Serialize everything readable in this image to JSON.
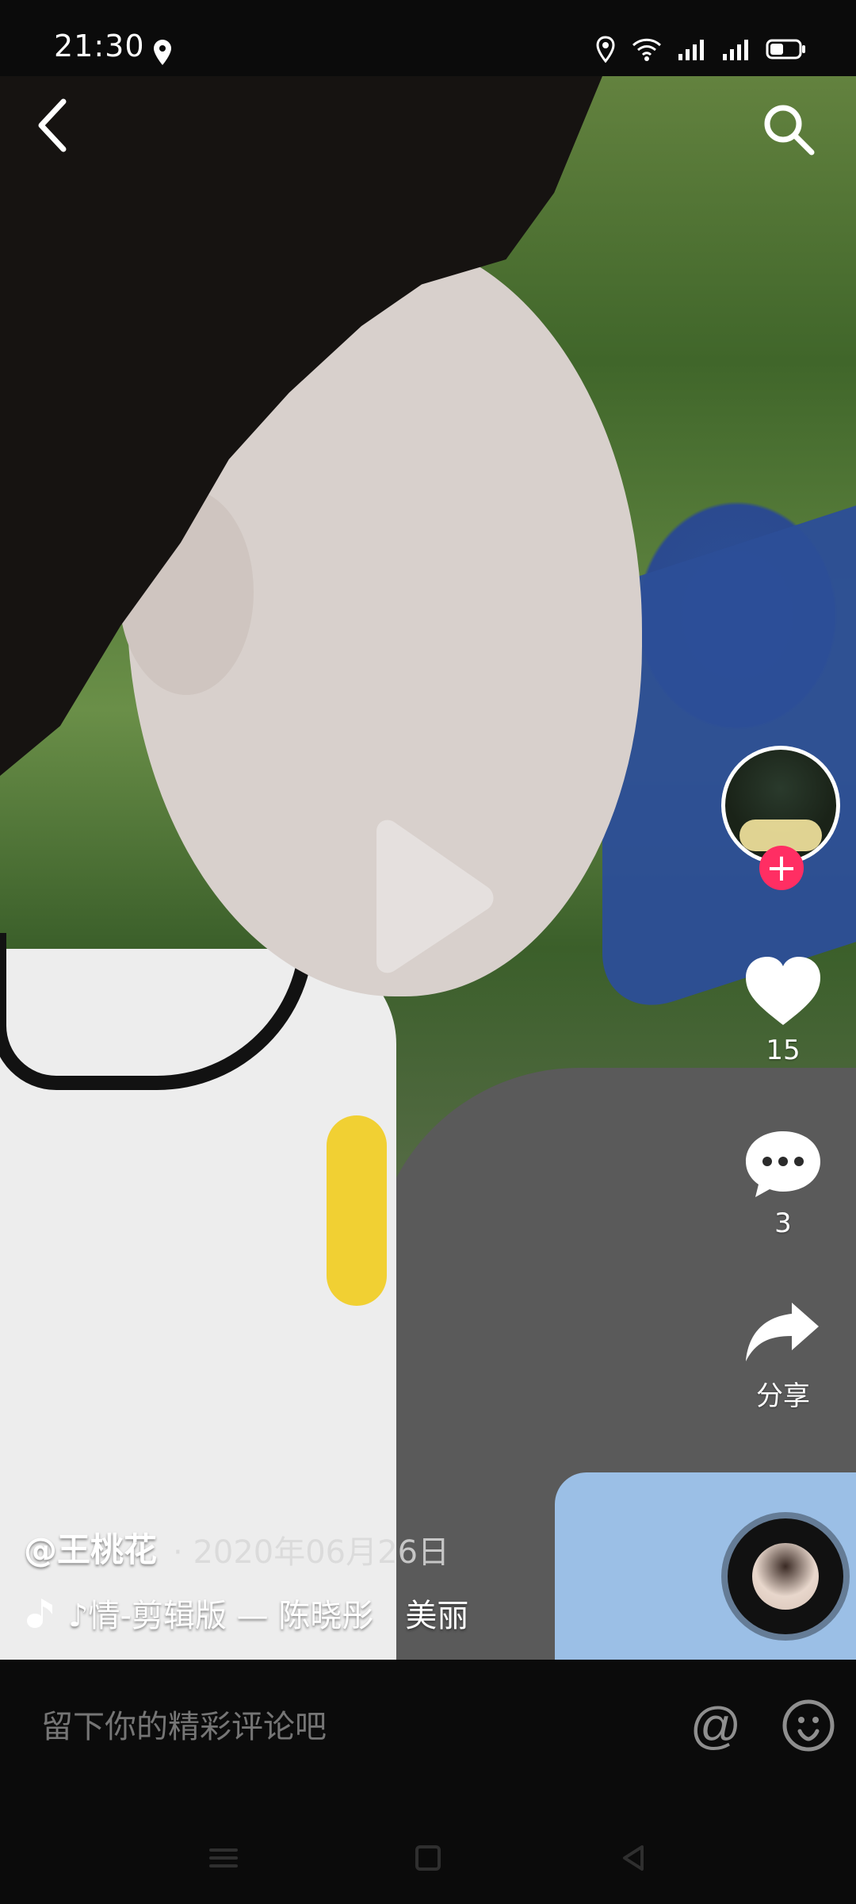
{
  "status_bar": {
    "time": "21:30"
  },
  "top_bar": {
    "back_label": "<",
    "search_label": "search"
  },
  "video": {
    "play_state": "paused"
  },
  "actions": {
    "like_count": "15",
    "comment_count": "3",
    "share_label": "分享",
    "follow_label": "+"
  },
  "post": {
    "author": "@王桃花",
    "date_separator": "·",
    "date": "2020年06月26日",
    "music": "♪情-剪辑版 — 陈晓彤　美丽"
  },
  "comment": {
    "placeholder": "留下你的精彩评论吧",
    "at_label": "@"
  },
  "colors": {
    "accent": "#ff2e63",
    "background": "#0b0b0b",
    "muted_text": "#8b8b8b"
  },
  "icons": {
    "back": "chevron-left-icon",
    "search": "search-icon",
    "play": "play-icon",
    "like": "heart-icon",
    "comment": "comment-icon",
    "share": "share-icon",
    "music": "music-note-icon",
    "emoji": "emoji-icon",
    "nav_menu": "menu-icon",
    "nav_home": "home-square-icon",
    "nav_back": "back-triangle-icon"
  }
}
